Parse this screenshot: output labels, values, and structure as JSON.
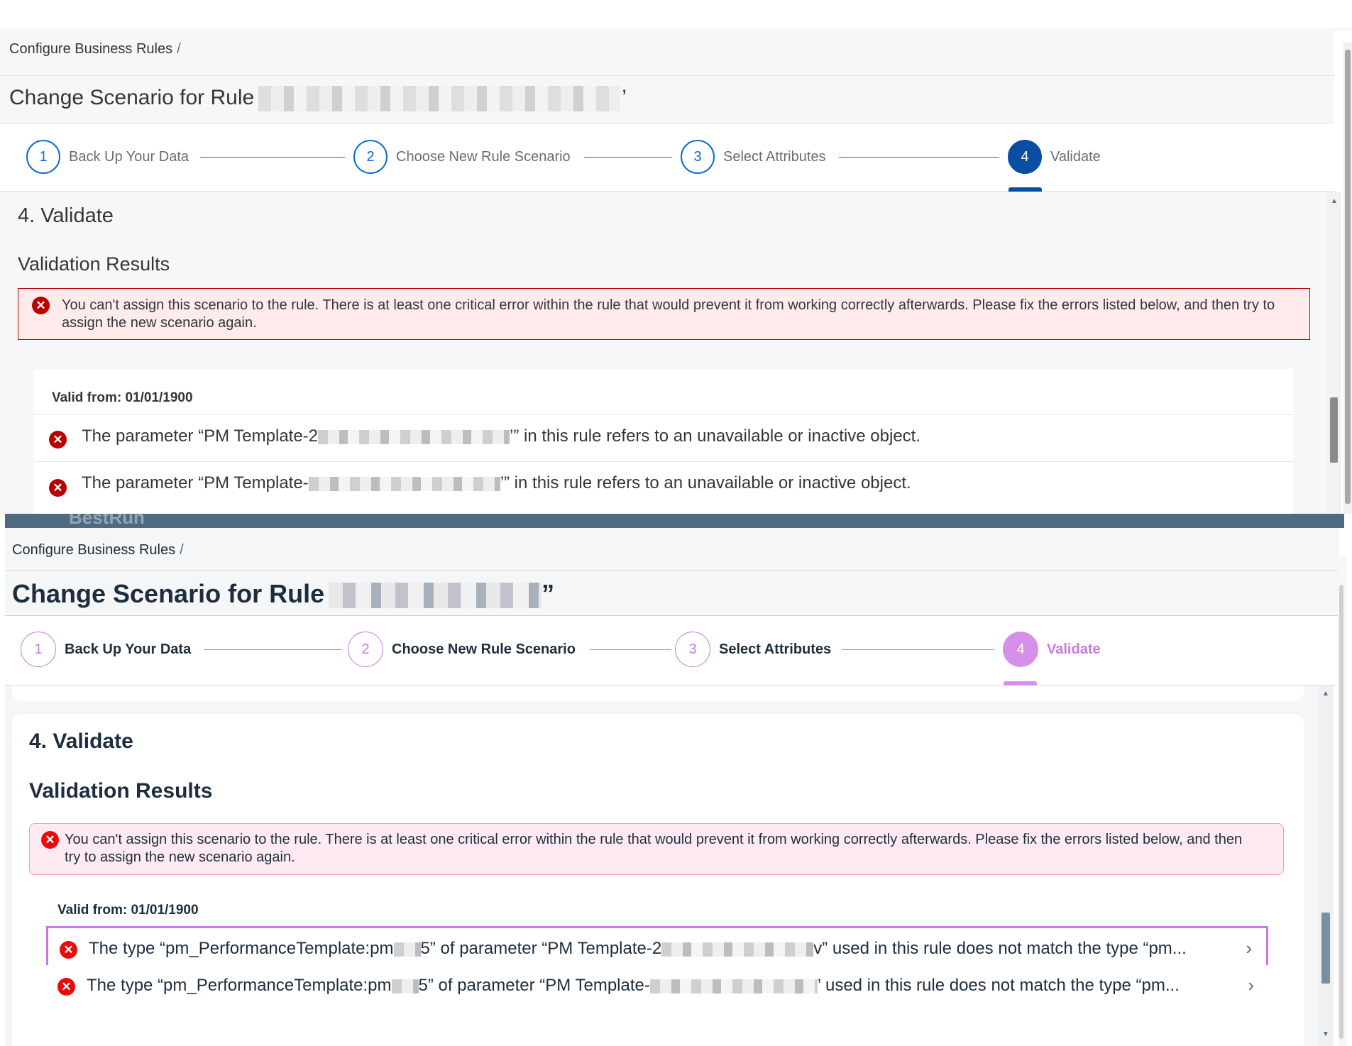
{
  "top": {
    "breadcrumb": "Configure Business Rules",
    "breadcrumb_sep": "/",
    "title_prefix": "Change Scenario for Rule",
    "title_suffix": "’",
    "steps": [
      {
        "num": "1",
        "label": "Back Up Your Data"
      },
      {
        "num": "2",
        "label": "Choose New Rule Scenario"
      },
      {
        "num": "3",
        "label": "Select Attributes"
      },
      {
        "num": "4",
        "label": "Validate"
      }
    ],
    "section_title": "4. Validate",
    "results_title": "Validation Results",
    "error_message": "You can't assign this scenario to the rule. There is at least one critical error within the rule that would prevent it from working correctly afterwards. Please fix the errors listed below, and then try to assign the new scenario again.",
    "valid_from": "Valid from: 01/01/1900",
    "rows": [
      {
        "pre": "The parameter “PM Template-2",
        "post": "’” in this rule refers to an unavailable or inactive object."
      },
      {
        "pre": "The parameter “PM Template-",
        "post": "’” in this rule refers to an unavailable or inactive object."
      }
    ]
  },
  "bottom": {
    "brand": "BestRun",
    "breadcrumb": "Configure Business Rules",
    "breadcrumb_sep": "/",
    "title_prefix": "Change Scenario for Rule",
    "title_suffix": "”",
    "steps": [
      {
        "num": "1",
        "label": "Back Up Your Data"
      },
      {
        "num": "2",
        "label": "Choose New Rule Scenario"
      },
      {
        "num": "3",
        "label": "Select Attributes"
      },
      {
        "num": "4",
        "label": "Validate"
      }
    ],
    "section_title": "4. Validate",
    "results_title": "Validation Results",
    "error_message": "You can't assign this scenario to the rule. There is at least one critical error within the rule that would prevent it from working correctly afterwards. Please fix the errors listed below, and then try to assign the new scenario again.",
    "valid_from": "Valid from: 01/01/1900",
    "rows": [
      {
        "a": "The type “pm_PerformanceTemplate:pm",
        "b": "5” of parameter “PM Template-2",
        "c": "v” used in this rule does not match the type “pm..."
      },
      {
        "a": "The type “pm_PerformanceTemplate:pm",
        "b": "5” of parameter “PM Template-",
        "c": "’ used in this rule does not match the type “pm..."
      }
    ]
  },
  "colors": {
    "classic_accent": "#0a6ed1",
    "horizon_accent": "#c87ae0",
    "error": "#bb0000"
  },
  "icons": {
    "error": "error-circle-icon",
    "chevron": "chevron-right-icon"
  }
}
